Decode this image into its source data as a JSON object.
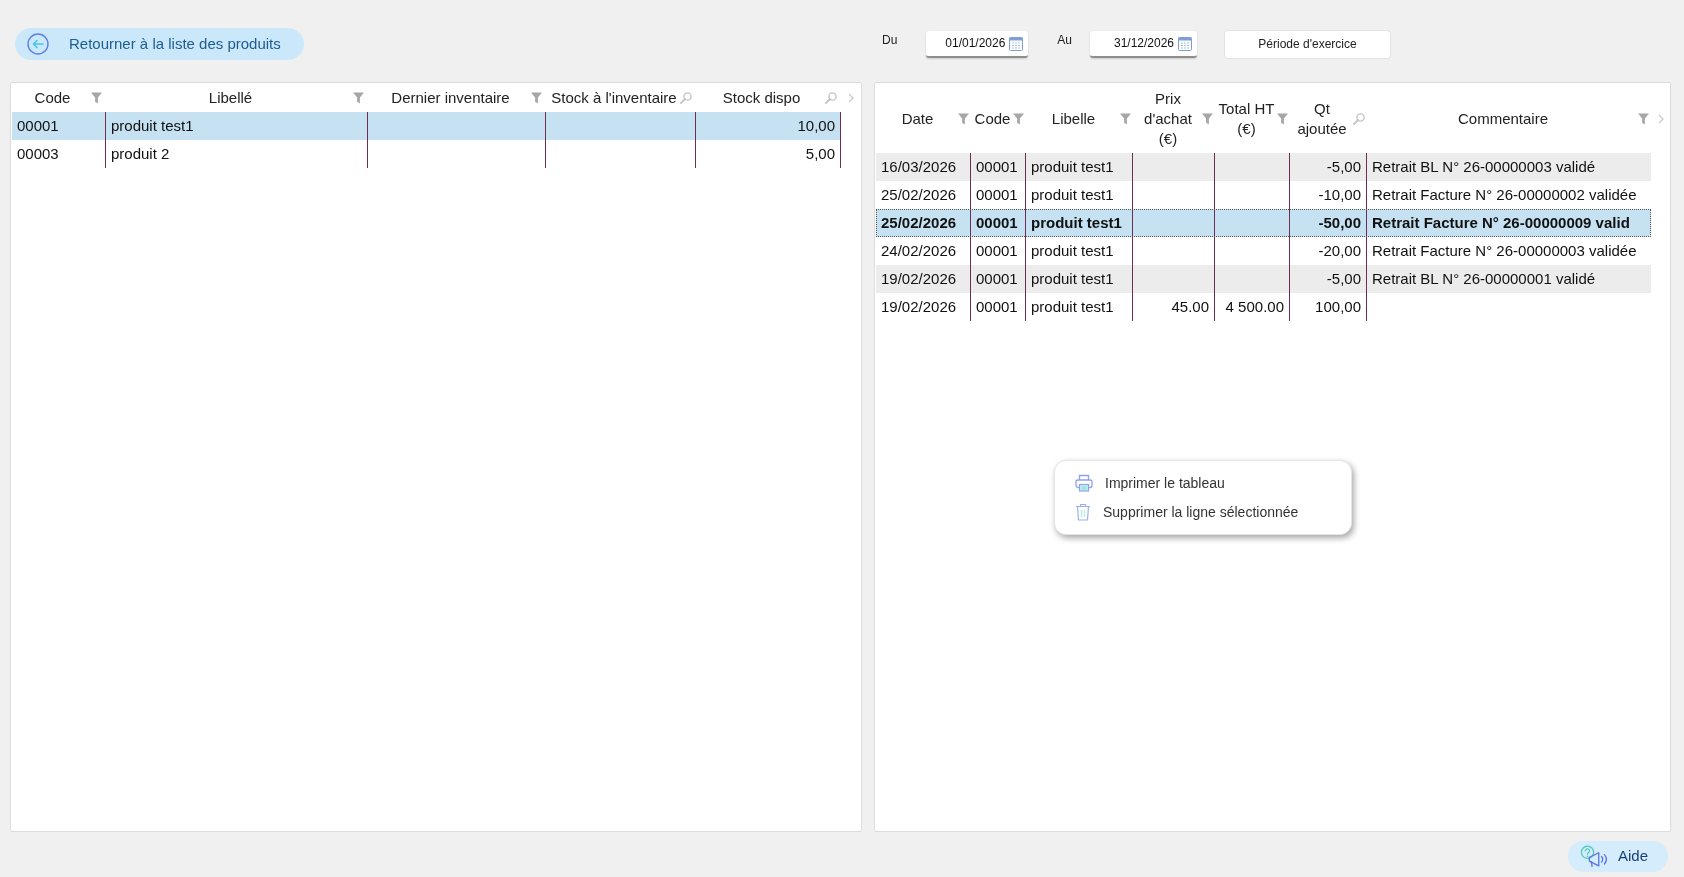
{
  "back_button": {
    "label": "Retourner à la liste des produits"
  },
  "period": {
    "from": {
      "label": "Du",
      "value": "01/01/2026"
    },
    "to": {
      "label": "Au",
      "value": "31/12/2026"
    },
    "button": "Période d'exercice"
  },
  "products_table": {
    "columns": [
      {
        "label": "Code",
        "kind": "filter"
      },
      {
        "label": "Libellé",
        "kind": "filter"
      },
      {
        "label": "Dernier inventaire",
        "kind": "filter"
      },
      {
        "label": "Stock à l'inventaire",
        "kind": "search"
      },
      {
        "label": "Stock dispo",
        "kind": "search"
      }
    ],
    "rows": [
      {
        "code": "00001",
        "libelle": "produit test1",
        "stock_dispo": "10,00",
        "selected": true
      },
      {
        "code": "00003",
        "libelle": "produit 2",
        "stock_dispo": "5,00",
        "selected": false
      }
    ]
  },
  "movements_table": {
    "columns": [
      {
        "label": "Date",
        "kind": "filter"
      },
      {
        "label": "Code",
        "kind": "filter"
      },
      {
        "label": "Libelle",
        "kind": "filter"
      },
      {
        "label": "Prix d'achat (€)",
        "kind": "filter"
      },
      {
        "label": "Total HT (€)",
        "kind": "filter"
      },
      {
        "label": "Qt ajoutée",
        "kind": "search"
      },
      {
        "label": "Commentaire",
        "kind": "filter"
      }
    ],
    "rows": [
      {
        "date": "16/03/2026",
        "code": "00001",
        "libelle": "produit test1",
        "qt_ajoutee": "-5,00",
        "commentaire": "Retrait BL N° 26-00000003 validé",
        "selected": false
      },
      {
        "date": "25/02/2026",
        "code": "00001",
        "libelle": "produit test1",
        "qt_ajoutee": "-10,00",
        "commentaire": "Retrait Facture N° 26-00000002 validée",
        "selected": false
      },
      {
        "date": "25/02/2026",
        "code": "00001",
        "libelle": "produit test1",
        "qt_ajoutee": "-50,00",
        "commentaire": "Retrait Facture N° 26-00000009 valid",
        "selected": true
      },
      {
        "date": "24/02/2026",
        "code": "00001",
        "libelle": "produit test1",
        "qt_ajoutee": "-20,00",
        "commentaire": "Retrait Facture N° 26-00000003 validée",
        "selected": false
      },
      {
        "date": "19/02/2026",
        "code": "00001",
        "libelle": "produit test1",
        "qt_ajoutee": "-5,00",
        "commentaire": "Retrait BL N° 26-00000001 validé",
        "selected": false
      },
      {
        "date": "19/02/2026",
        "code": "00001",
        "libelle": "produit test1",
        "prix_achat": "45.00",
        "total_ht": "4 500.00",
        "qt_ajoutee": "100,00",
        "selected": false
      }
    ]
  },
  "context_menu": {
    "items": [
      {
        "kind": "print",
        "label": "Imprimer le tableau"
      },
      {
        "kind": "delete",
        "label": "Supprimer la ligne sélectionnée"
      }
    ]
  },
  "help_button": {
    "label": "Aide"
  }
}
